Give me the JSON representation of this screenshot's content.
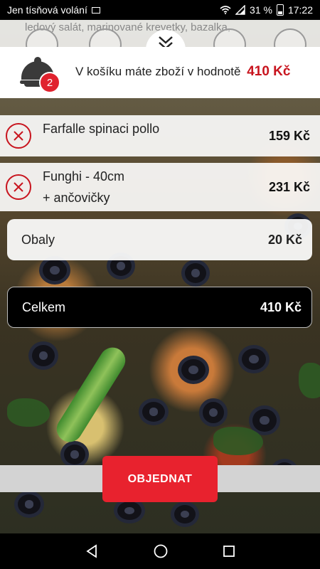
{
  "status_bar": {
    "carrier": "Jen tísňová volání",
    "battery": "31 %",
    "time": "17:22"
  },
  "background": {
    "text": "ledový salát, marinované krevetky, bazalka,"
  },
  "cart_header": {
    "badge_count": "2",
    "message": "V košíku máte zboží v hodnotě",
    "total": "410 Kč"
  },
  "items": [
    {
      "name": "Farfalle spinaci pollo",
      "extra": "",
      "price": "159 Kč"
    },
    {
      "name": "Funghi - 40cm",
      "extra": "+ ančovičky",
      "price": "231 Kč"
    }
  ],
  "packaging": {
    "label": "Obaly",
    "price": "20 Kč"
  },
  "total": {
    "label": "Celkem",
    "price": "410 Kč"
  },
  "order_button": {
    "label": "OBJEDNAT"
  },
  "colors": {
    "accent": "#e8222e",
    "price_red": "#c8141e"
  }
}
